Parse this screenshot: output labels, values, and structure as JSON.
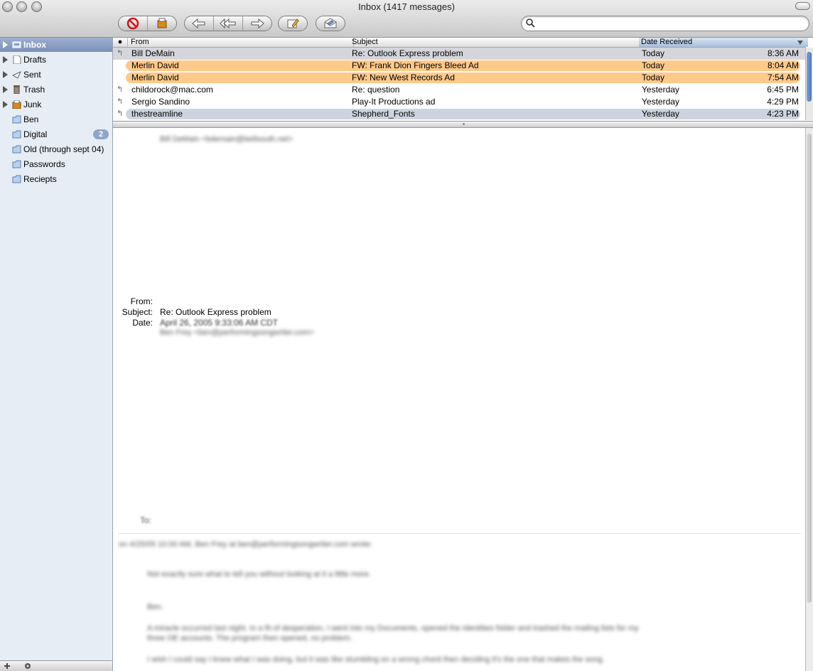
{
  "window": {
    "title": "Inbox (1417 messages)"
  },
  "toolbar": {
    "buttons": [
      "delete-icon",
      "junk-icon",
      "reply-icon",
      "reply-all-icon",
      "forward-icon",
      "compose-icon",
      "get-mail-icon"
    ],
    "search_placeholder": ""
  },
  "sidebar": {
    "items": [
      {
        "label": "Inbox",
        "icon": "inbox-icon",
        "expandable": true,
        "selected": true
      },
      {
        "label": "Drafts",
        "icon": "drafts-icon",
        "expandable": true
      },
      {
        "label": "Sent",
        "icon": "sent-icon",
        "expandable": true
      },
      {
        "label": "Trash",
        "icon": "trash-icon",
        "expandable": true
      },
      {
        "label": "Junk",
        "icon": "junk-icon",
        "expandable": true
      },
      {
        "label": "Ben",
        "icon": "folder-icon"
      },
      {
        "label": "Digital",
        "icon": "folder-icon",
        "badge": "2"
      },
      {
        "label": "Old (through sept 04)",
        "icon": "folder-icon"
      },
      {
        "label": "Passwords",
        "icon": "folder-icon"
      },
      {
        "label": "Reciepts",
        "icon": "folder-icon"
      }
    ]
  },
  "list": {
    "columns": {
      "status": "●",
      "from": "From",
      "subject": "Subject",
      "date": "Date Received"
    },
    "rows": [
      {
        "status": "↰",
        "from": "Bill DeMain",
        "subject": "Re: Outlook Express problem",
        "date": "Today",
        "time": "8:36 AM",
        "style": "gray"
      },
      {
        "status": "",
        "from": "Merlin David",
        "subject": "FW: Frank Dion Fingers Bleed Ad",
        "date": "Today",
        "time": "8:04 AM",
        "style": "orange"
      },
      {
        "status": "",
        "from": "Merlin David",
        "subject": "FW: New West Records Ad",
        "date": "Today",
        "time": "7:54 AM",
        "style": "orange"
      },
      {
        "status": "↰",
        "from": "childorock@mac.com",
        "subject": "Re: question",
        "date": "Yesterday",
        "time": "6:45 PM",
        "style": ""
      },
      {
        "status": "↰",
        "from": "Sergio Sandino",
        "subject": "Play-It Productions ad",
        "date": "Yesterday",
        "time": "4:29 PM",
        "style": ""
      },
      {
        "status": "↰",
        "from": "thestreamline",
        "subject": "Shepherd_Fonts",
        "date": "Yesterday",
        "time": "4:23 PM",
        "style": "lastsel"
      }
    ]
  },
  "message": {
    "blurred_from_line": "Bill DeMain <bdemain@bellsouth.net>",
    "from_label": "From:",
    "subject_label": "Subject:",
    "subject_value": "Re: Outlook Express problem",
    "date_label": "Date:",
    "date_value": "April 26, 2005 9:33:06 AM CDT",
    "blurred_to_line": "Ben Frey <ben@performingsongwriter.com>",
    "to_label": "To:",
    "body_lines": [
      "on 4/25/05 10:00 AM, Ben Frey at ben@performingsongwriter.com wrote:",
      "Not exactly sure what to tell you without looking at it a little more.",
      "Ben.",
      "A miracle occurred last night. In a fit of desperation, I went into my Documents, opened the Identities folder and trashed the mailing lists for my",
      "three OE accounts. The program then opened, no problem.",
      "I wish I could say I knew what I was doing, but it was like stumbling on a wrong chord then deciding it's the one that makes the song."
    ]
  }
}
